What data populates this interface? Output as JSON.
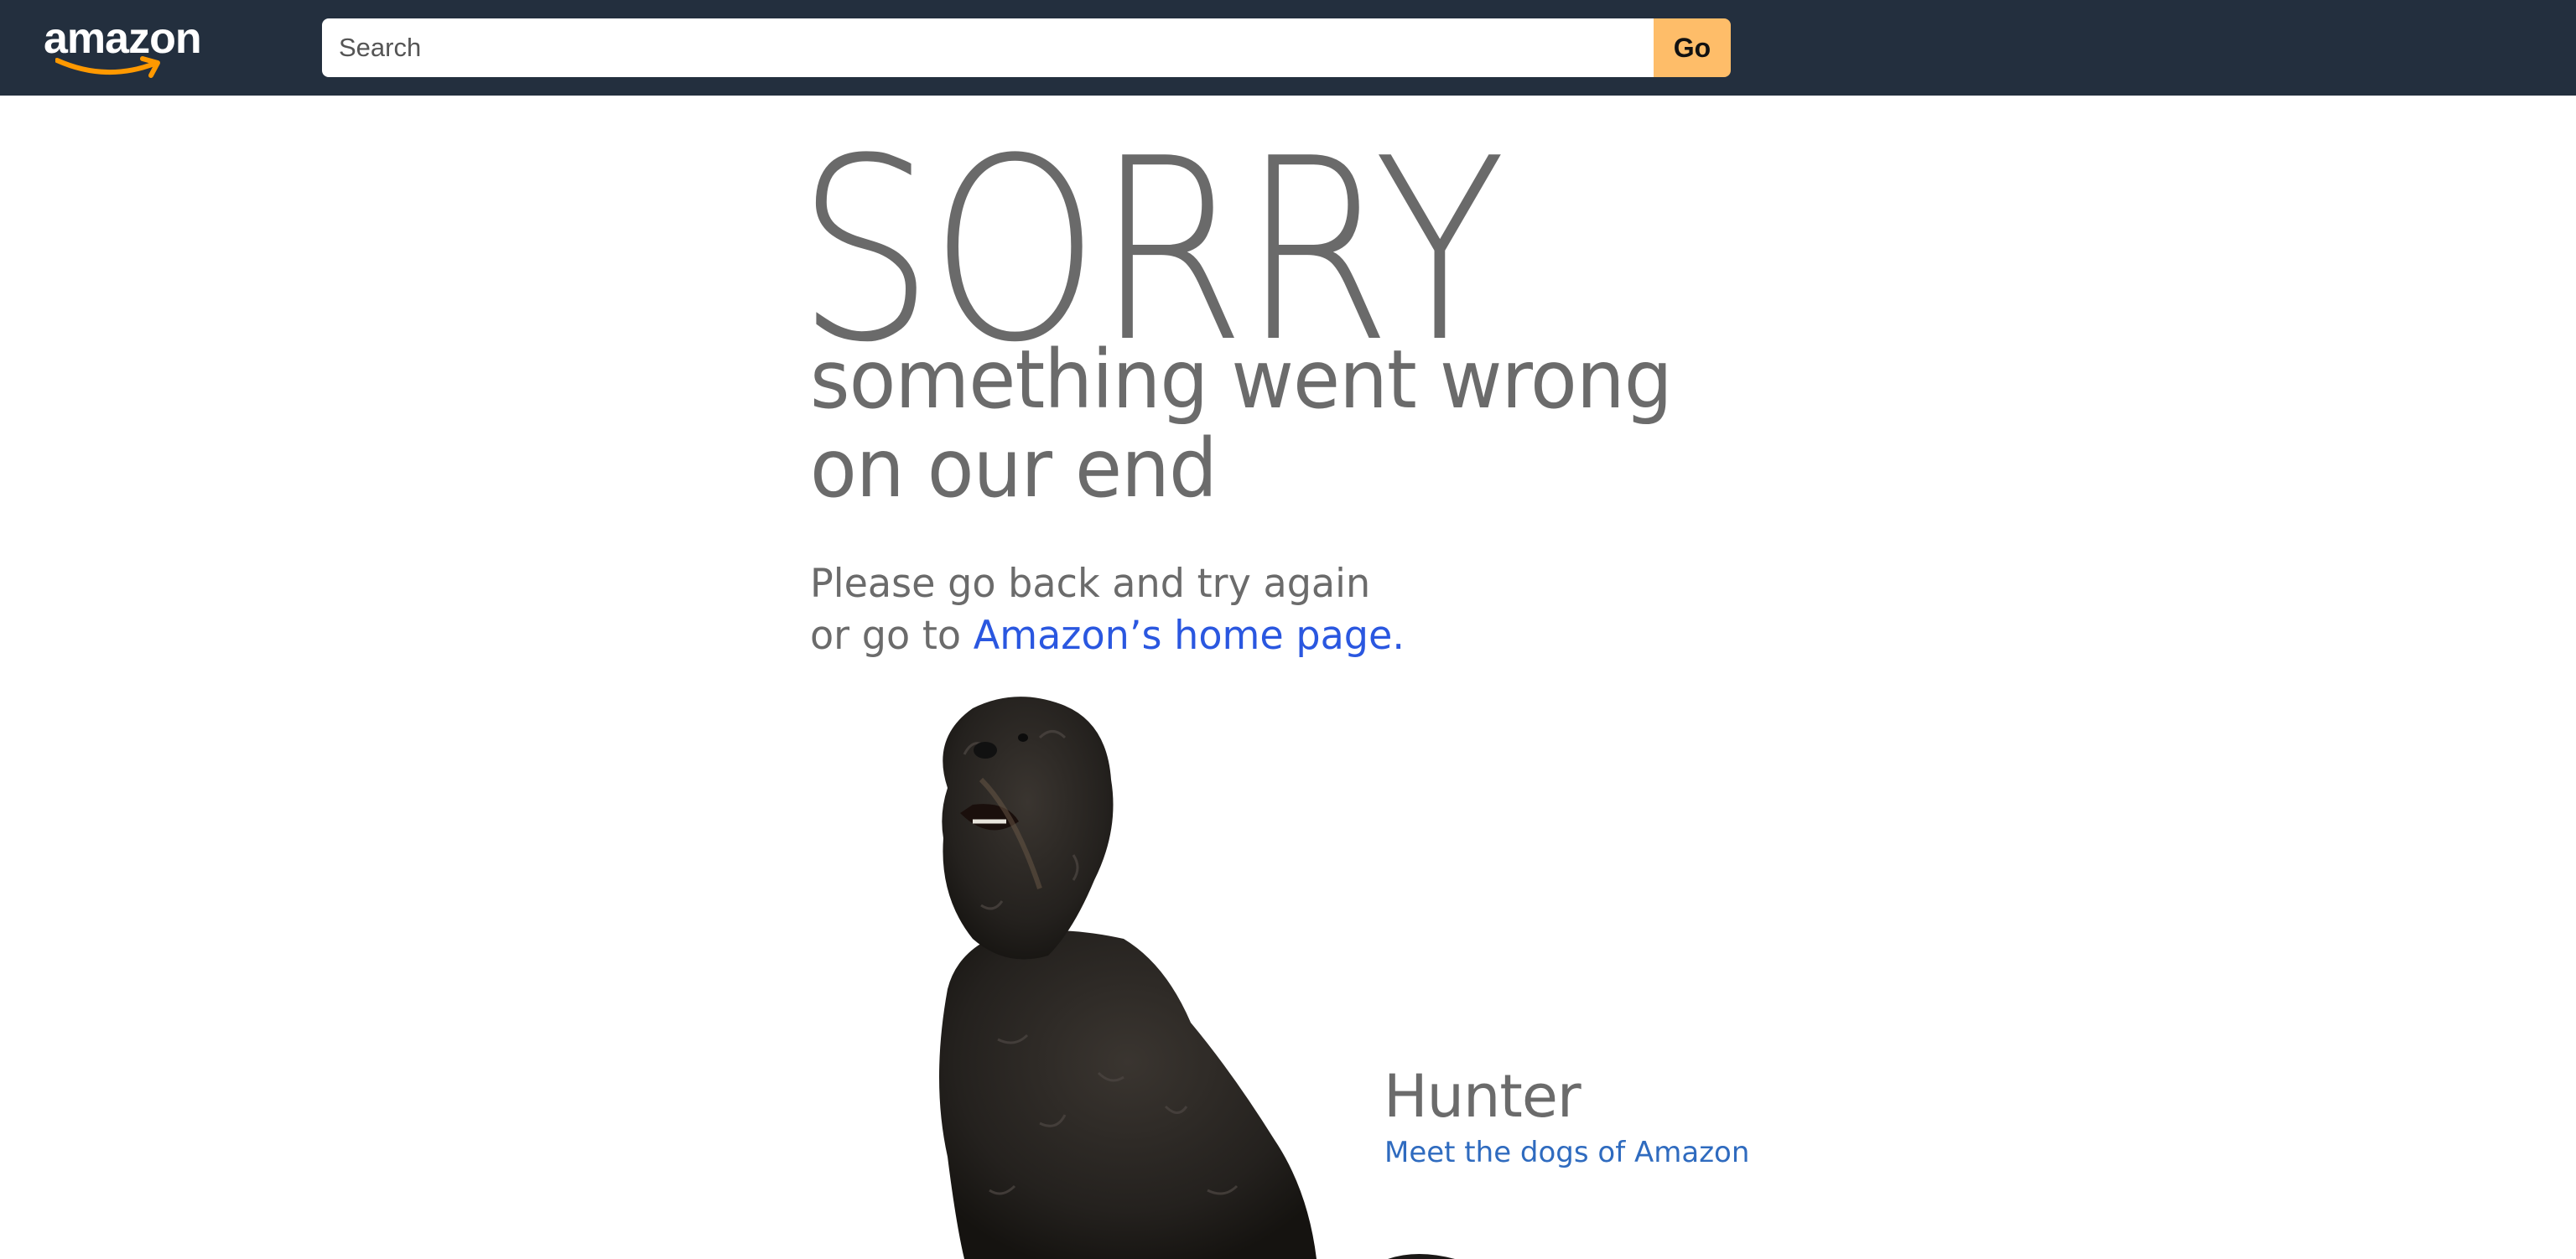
{
  "header": {
    "logo_text": "amazon",
    "search_placeholder": "Search",
    "go_label": "Go",
    "background_color": "#232f3e",
    "go_button_color": "#febd69",
    "logo_smile_color": "#ff9900"
  },
  "error": {
    "heading": "SORRY",
    "subtitle_line1": "something went wrong",
    "subtitle_line2": "on our end",
    "message_line1": "Please go back and try again",
    "message_line2_prefix": "or go to ",
    "home_link_label": "Amazon’s home page.",
    "text_color": "#6b6b6b",
    "link_color": "#2a57e0"
  },
  "dog": {
    "name": "Hunter",
    "link_label": "Meet the dogs of Amazon",
    "link_color": "#2f6bbf"
  }
}
